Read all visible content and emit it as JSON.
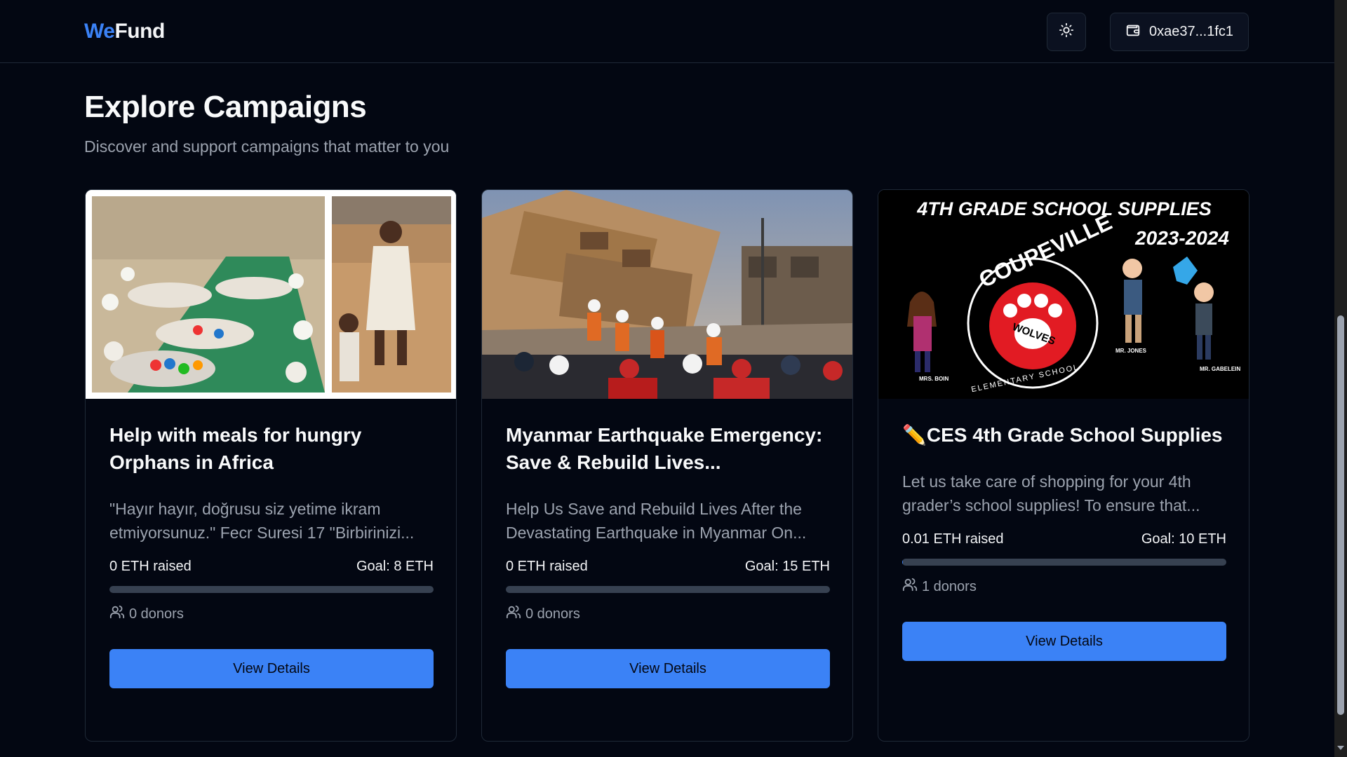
{
  "header": {
    "logo_we": "We",
    "logo_fund": "Fund",
    "theme_toggle_icon": "sun-icon",
    "wallet_icon": "wallet-icon",
    "wallet_address": "0xae37...1fc1"
  },
  "page": {
    "title": "Explore Campaigns",
    "subtitle": "Discover and support campaigns that matter to you"
  },
  "campaigns": [
    {
      "title": "Help with meals for hungry Orphans in Africa",
      "description": "\"Hayır hayır, doğrusu siz yetime ikram etmiyorsunuz.\" Fecr Suresi 17 \"Birbirinizi...",
      "raised": "0 ETH raised",
      "goal": "Goal: 8 ETH",
      "progress": 0,
      "donors": "0 donors",
      "button": "View Details"
    },
    {
      "title": "Myanmar Earthquake Emergency: Save & Rebuild Lives...",
      "description": "Help Us Save and Rebuild Lives After the Devastating Earthquake in Myanmar On...",
      "raised": "0 ETH raised",
      "goal": "Goal: 15 ETH",
      "progress": 0,
      "donors": "0 donors",
      "button": "View Details"
    },
    {
      "title": "✏️CES 4th Grade School Supplies",
      "description": "Let us take care of shopping for your 4th grader’s school supplies! To ensure that...",
      "raised": "0.01 ETH raised",
      "goal": "Goal: 10 ETH",
      "progress": 0.001,
      "donors": "1 donors",
      "button": "View Details"
    }
  ],
  "poster": {
    "heading": "4TH GRADE SCHOOL SUPPLIES",
    "year": "2023-2024",
    "school_arc": "COUPEVILLE",
    "school_bottom": "ELEMENTARY SCHOOL",
    "mascot": "WOLVES",
    "teacher_1": "MRS. BOIN",
    "teacher_2": "MR. JONES",
    "teacher_3": "MR. GABELEIN"
  },
  "colors": {
    "background": "#030712",
    "accent": "#3b82f6",
    "logo_accent": "#3b82f6",
    "muted_text": "#9ca3af",
    "border": "#1f2937"
  }
}
